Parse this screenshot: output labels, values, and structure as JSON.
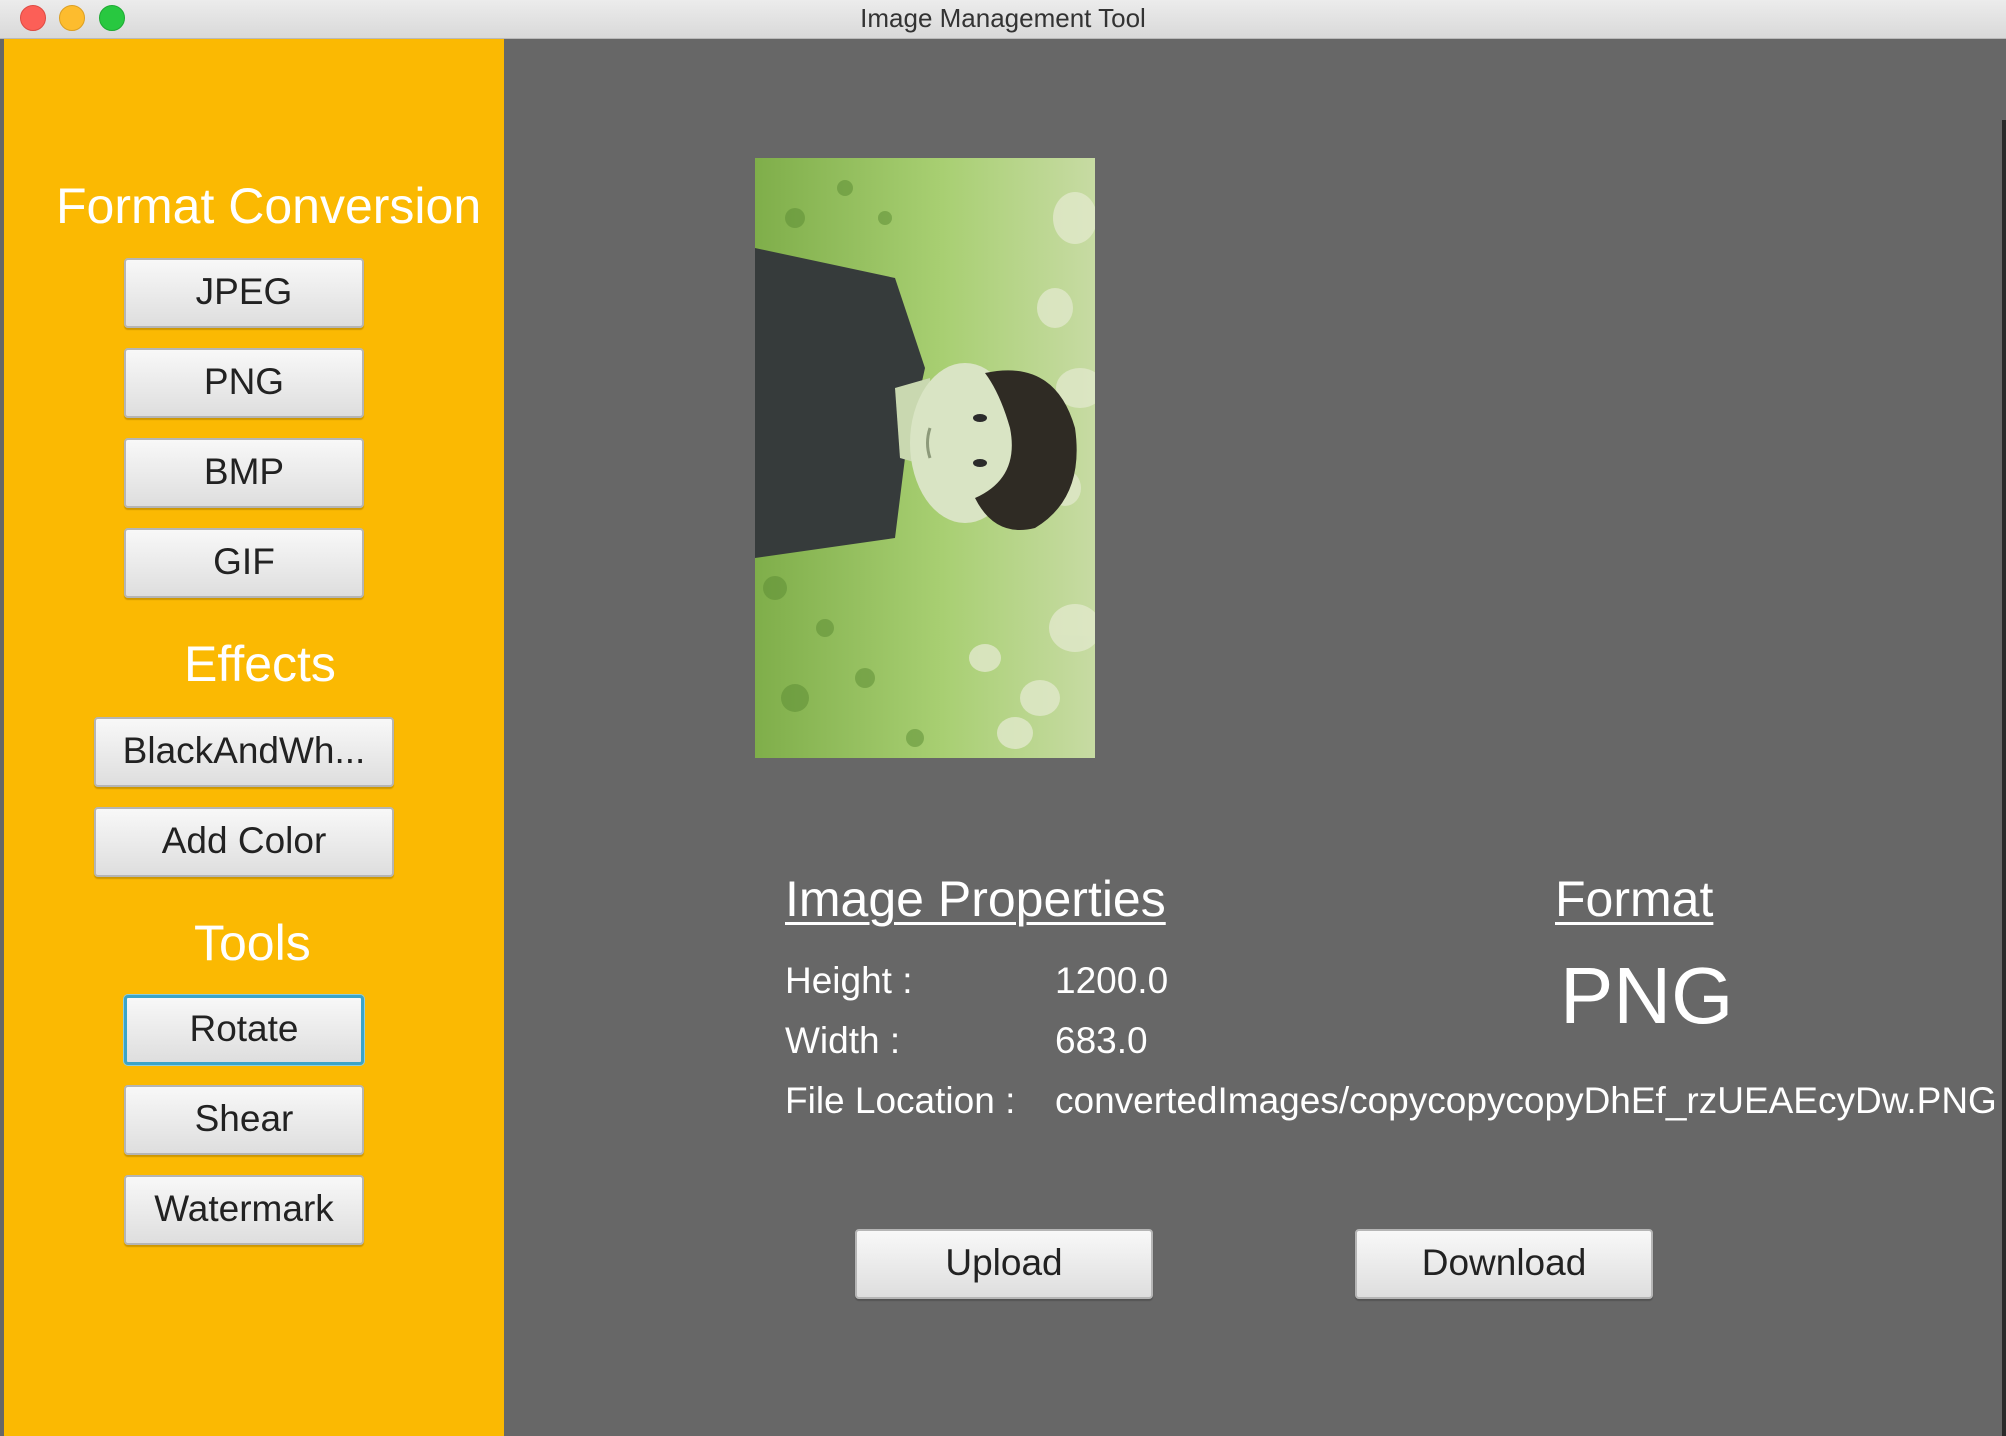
{
  "window": {
    "title": "Image Management Tool"
  },
  "sidebar": {
    "format_conversion": {
      "title": "Format Conversion",
      "buttons": [
        "JPEG",
        "PNG",
        "BMP",
        "GIF"
      ]
    },
    "effects": {
      "title": "Effects",
      "buttons": [
        "BlackAndWh...",
        "Add Color"
      ]
    },
    "tools": {
      "title": "Tools",
      "buttons": [
        "Rotate",
        "Shear",
        "Watermark"
      ],
      "focused": "Rotate"
    }
  },
  "properties": {
    "heading": "Image Properties",
    "height_label": "Height  :",
    "height_value": "1200.0",
    "width_label": "Width :",
    "width_value": "683.0",
    "location_label": "File Location :",
    "location_value": "convertedImages/copycopycopyDhEf_rzUEAEcyDw.PNG"
  },
  "format": {
    "heading": "Format",
    "value": "PNG"
  },
  "actions": {
    "upload_label": "Upload",
    "download_label": "Download"
  },
  "colors": {
    "sidebar_bg": "#fbb902",
    "content_bg": "#676767",
    "focus_ring": "#3ba4c8"
  }
}
